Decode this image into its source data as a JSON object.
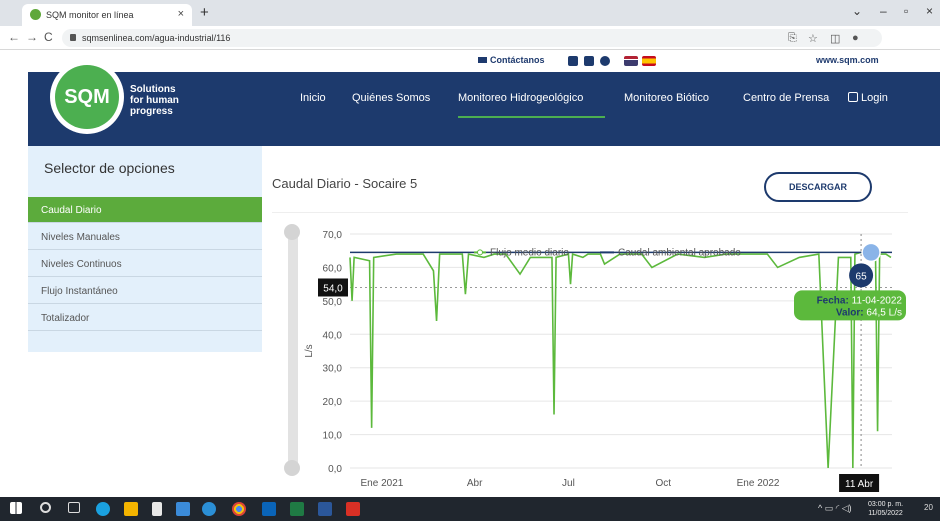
{
  "browser": {
    "tab_title": "SQM monitor en línea",
    "tab_close": "×",
    "new_tab": "+",
    "url": "sqmsenlinea.com/agua-industrial/116",
    "back": "←",
    "forward": "→",
    "reload": "C",
    "share": "⎘",
    "star": "☆",
    "sidebar_toggle": "◫",
    "profile": "●",
    "minimize": "⌄",
    "min": "–",
    "restore": "▫",
    "close": "×"
  },
  "topbar": {
    "contact": "Contáctanos",
    "website": "www.sqm.com"
  },
  "logo": {
    "mark": "SQM",
    "tagline_1": "Solutions",
    "tagline_2": "for human",
    "tagline_3": "progress"
  },
  "nav": {
    "items": [
      "Inicio",
      "Quiénes Somos",
      "Monitoreo Hidrogeológico",
      "Monitoreo Biótico",
      "Centro de Prensa"
    ],
    "login": "Login",
    "active_index": 2
  },
  "sidebar": {
    "title": "Selector de opciones",
    "items": [
      "Caudal Diario",
      "Niveles Manuales",
      "Niveles Continuos",
      "Flujo Instantáneo",
      "Totalizador"
    ],
    "active_index": 0
  },
  "main": {
    "title": "Caudal Diario - Socaire 5",
    "download": "DESCARGAR"
  },
  "chart_data": {
    "type": "line",
    "ylabel": "L/s",
    "ylim": [
      0,
      70
    ],
    "y_ticks": [
      "0,0",
      "10,0",
      "20,0",
      "30,0",
      "40,0",
      "50,0",
      "60,0",
      "70,0"
    ],
    "x_ticks": [
      "Ene 2021",
      "Abr",
      "Jul",
      "Oct",
      "Ene 2022"
    ],
    "x_range": [
      "2020-12-01",
      "2022-05-11"
    ],
    "series": [
      {
        "name": "Flujo medio diario",
        "color": "#5cb93c",
        "x": [
          "2020-12-01",
          "2020-12-03",
          "2020-12-05",
          "2020-12-20",
          "2020-12-22",
          "2020-12-24",
          "2021-01-15",
          "2021-01-20",
          "2021-02-10",
          "2021-02-20",
          "2021-02-23",
          "2021-02-26",
          "2021-03-20",
          "2021-03-23",
          "2021-03-26",
          "2021-04-10",
          "2021-04-20",
          "2021-05-01",
          "2021-05-15",
          "2021-05-25",
          "2021-06-15",
          "2021-06-17",
          "2021-06-19",
          "2021-07-01",
          "2021-07-03",
          "2021-07-05",
          "2021-07-15",
          "2021-07-20",
          "2021-08-01",
          "2021-08-05",
          "2021-08-20",
          "2021-09-10",
          "2021-09-20",
          "2021-10-15",
          "2021-11-10",
          "2021-12-01",
          "2021-12-20",
          "2022-01-10",
          "2022-01-20",
          "2022-02-10",
          "2022-03-01",
          "2022-03-10",
          "2022-03-20",
          "2022-03-30",
          "2022-04-01",
          "2022-04-03",
          "2022-04-05",
          "2022-04-11",
          "2022-04-20",
          "2022-04-25",
          "2022-04-27",
          "2022-04-29",
          "2022-05-05",
          "2022-05-10"
        ],
        "y": [
          63,
          50,
          63,
          62,
          12,
          63,
          64,
          64,
          64,
          59,
          44,
          64,
          64,
          52,
          64,
          63,
          64,
          64,
          58,
          63,
          63,
          16,
          63,
          64,
          55,
          64,
          63,
          64,
          64,
          61,
          64,
          64,
          60,
          64,
          63,
          64,
          64,
          64,
          60,
          63,
          64,
          0,
          63,
          63,
          63,
          0,
          64,
          64.5,
          64,
          64,
          11,
          64,
          64,
          63
        ]
      },
      {
        "name": "Caudal ambiental aprobado",
        "color": "#1d3a6d",
        "x": [
          "2020-12-01",
          "2022-05-11"
        ],
        "y": [
          64.5,
          64.5
        ]
      }
    ],
    "crosshair_value": "54,0",
    "reference_value": 54.0,
    "tooltip": {
      "date_label": "Fecha:",
      "date": "11-04-2022",
      "value_label": "Valor:",
      "value": "64,5 L/s"
    },
    "marker_label": "65",
    "x_cursor_label": "11 Abr"
  },
  "taskbar": {
    "time": "03:00 p. m.",
    "date": "11/05/2022",
    "notif": "20"
  }
}
